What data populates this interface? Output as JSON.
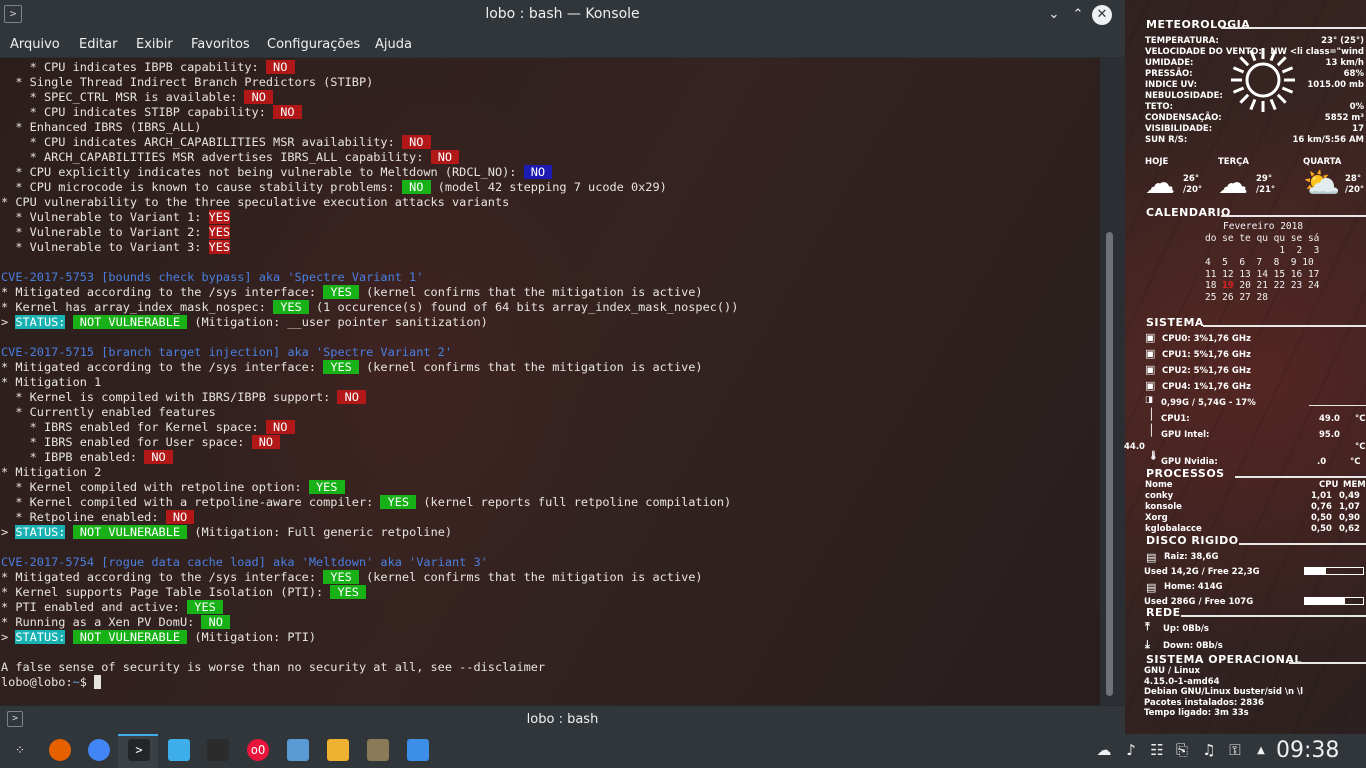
{
  "window": {
    "title": "lobo : bash — Konsole",
    "status_title": "lobo : bash"
  },
  "menu": [
    "Arquivo",
    "Editar",
    "Exibir",
    "Favoritos",
    "Configurações",
    "Ajuda"
  ],
  "terminal": {
    "lines": [
      [
        [
          "",
          "    * CPU indicates IBPB capability: "
        ],
        [
          "b-red",
          " NO "
        ]
      ],
      [
        [
          "",
          "  * Single Thread Indirect Branch Predictors (STIBP)"
        ]
      ],
      [
        [
          "",
          "    * SPEC_CTRL MSR is available: "
        ],
        [
          "b-red",
          " NO "
        ]
      ],
      [
        [
          "",
          "    * CPU indicates STIBP capability: "
        ],
        [
          "b-red",
          " NO "
        ]
      ],
      [
        [
          "",
          "  * Enhanced IBRS (IBRS_ALL)"
        ]
      ],
      [
        [
          "",
          "    * CPU indicates ARCH_CAPABILITIES MSR availability: "
        ],
        [
          "b-red",
          " NO "
        ]
      ],
      [
        [
          "",
          "    * ARCH_CAPABILITIES MSR advertises IBRS_ALL capability: "
        ],
        [
          "b-red",
          " NO "
        ]
      ],
      [
        [
          "",
          "  * CPU explicitly indicates not being vulnerable to Meltdown (RDCL_NO): "
        ],
        [
          "b-navy",
          " NO "
        ]
      ],
      [
        [
          "",
          "  * CPU microcode is known to cause stability problems: "
        ],
        [
          "b-green",
          " NO "
        ],
        [
          "",
          " (model 42 stepping 7 ucode 0x29)"
        ]
      ],
      [
        [
          "",
          "* CPU vulnerability to the three speculative execution attacks variants"
        ]
      ],
      [
        [
          "",
          "  * Vulnerable to Variant 1: "
        ],
        [
          "b-red",
          "YES"
        ]
      ],
      [
        [
          "",
          "  * Vulnerable to Variant 2: "
        ],
        [
          "b-red",
          "YES"
        ]
      ],
      [
        [
          "",
          "  * Vulnerable to Variant 3: "
        ],
        [
          "b-red",
          "YES"
        ]
      ],
      [],
      [
        [
          "c-blue",
          "CVE-2017-5753 [bounds check bypass] aka 'Spectre Variant 1'"
        ]
      ],
      [
        [
          "",
          "* Mitigated according to the /sys interface: "
        ],
        [
          "b-green",
          " YES "
        ],
        [
          "",
          " (kernel confirms that the mitigation is active)"
        ]
      ],
      [
        [
          "",
          "* Kernel has array_index_mask_nospec: "
        ],
        [
          "b-green",
          " YES "
        ],
        [
          "",
          " (1 occurence(s) found of 64 bits array_index_mask_nospec())"
        ]
      ],
      [
        [
          "",
          "> "
        ],
        [
          "b-cyan",
          "STATUS:"
        ],
        [
          "",
          " "
        ],
        [
          "b-green",
          " NOT VULNERABLE "
        ],
        [
          "",
          " (Mitigation: __user pointer sanitization)"
        ]
      ],
      [],
      [
        [
          "c-blue",
          "CVE-2017-5715 [branch target injection] aka 'Spectre Variant 2'"
        ]
      ],
      [
        [
          "",
          "* Mitigated according to the /sys interface: "
        ],
        [
          "b-green",
          " YES "
        ],
        [
          "",
          " (kernel confirms that the mitigation is active)"
        ]
      ],
      [
        [
          "",
          "* Mitigation 1"
        ]
      ],
      [
        [
          "",
          "  * Kernel is compiled with IBRS/IBPB support: "
        ],
        [
          "b-red",
          " NO "
        ]
      ],
      [
        [
          "",
          "  * Currently enabled features"
        ]
      ],
      [
        [
          "",
          "    * IBRS enabled for Kernel space: "
        ],
        [
          "b-red",
          " NO "
        ]
      ],
      [
        [
          "",
          "    * IBRS enabled for User space: "
        ],
        [
          "b-red",
          " NO "
        ]
      ],
      [
        [
          "",
          "    * IBPB enabled: "
        ],
        [
          "b-red",
          " NO "
        ]
      ],
      [
        [
          "",
          "* Mitigation 2"
        ]
      ],
      [
        [
          "",
          "  * Kernel compiled with retpoline option: "
        ],
        [
          "b-green",
          " YES "
        ]
      ],
      [
        [
          "",
          "  * Kernel compiled with a retpoline-aware compiler: "
        ],
        [
          "b-green",
          " YES "
        ],
        [
          "",
          " (kernel reports full retpoline compilation)"
        ]
      ],
      [
        [
          "",
          "  * Retpoline enabled: "
        ],
        [
          "b-red",
          " NO "
        ]
      ],
      [
        [
          "",
          "> "
        ],
        [
          "b-cyan",
          "STATUS:"
        ],
        [
          "",
          " "
        ],
        [
          "b-green",
          " NOT VULNERABLE "
        ],
        [
          "",
          " (Mitigation: Full generic retpoline)"
        ]
      ],
      [],
      [
        [
          "c-blue",
          "CVE-2017-5754 [rogue data cache load] aka 'Meltdown' aka 'Variant 3'"
        ]
      ],
      [
        [
          "",
          "* Mitigated according to the /sys interface: "
        ],
        [
          "b-green",
          " YES "
        ],
        [
          "",
          " (kernel confirms that the mitigation is active)"
        ]
      ],
      [
        [
          "",
          "* Kernel supports Page Table Isolation (PTI): "
        ],
        [
          "b-green",
          " YES "
        ]
      ],
      [
        [
          "",
          "* PTI enabled and active: "
        ],
        [
          "b-green",
          " YES "
        ]
      ],
      [
        [
          "",
          "* Running as a Xen PV DomU: "
        ],
        [
          "b-green",
          " NO "
        ]
      ],
      [
        [
          "",
          "> "
        ],
        [
          "b-cyan",
          "STATUS:"
        ],
        [
          "",
          " "
        ],
        [
          "b-green",
          " NOT VULNERABLE "
        ],
        [
          "",
          " (Mitigation: PTI)"
        ]
      ],
      [],
      [
        [
          "",
          "A false sense of security is worse than no security at all, see --disclaimer"
        ]
      ],
      [
        [
          "",
          "lobo@lobo"
        ],
        [
          "",
          ":"
        ],
        [
          "c-lb",
          "~"
        ],
        [
          "",
          "$ "
        ],
        [
          "cursor",
          " "
        ]
      ]
    ]
  },
  "conky": {
    "meteo": {
      "title": "METEOROLOGIA",
      "rows": [
        [
          "TEMPERATURA:",
          "23° (25°)"
        ],
        [
          "VELOCIDADE DO VENTO:",
          "NW <li class=\"wind"
        ],
        [
          "UMIDADE:",
          "13 km/h"
        ],
        [
          "PRESSÃO:",
          "68%"
        ],
        [
          "INDICE UV:",
          "1015.00 mb"
        ],
        [
          "NEBULOSIDADE:",
          ""
        ],
        [
          "TETO:",
          "0%"
        ],
        [
          "CONDENSAÇÃO:",
          "5852 m³"
        ],
        [
          "VISIBILIDADE:",
          "17"
        ],
        [
          "SUN R/S:",
          "16 km/5:56 AM"
        ]
      ],
      "days": [
        {
          "name": "HOJE",
          "hi": "26°",
          "lo": "/20°"
        },
        {
          "name": "TERÇA",
          "hi": "29°",
          "lo": "/21°"
        },
        {
          "name": "QUARTA",
          "hi": "28°",
          "lo": "/20°"
        }
      ]
    },
    "calendar": {
      "title": "CALENDARIO",
      "month": "Fevereiro 2018",
      "header": "do se te qu qu se sá",
      "weeks": [
        "             1  2  3",
        "4  5  6  7  8  9 10",
        "11 12 13 14 15 16 17",
        "18 19 20 21 22 23 24",
        "25 26 27 28"
      ],
      "today": "19"
    },
    "system": {
      "title": "SISTEMA",
      "cpus": [
        [
          "CPU0: 3%",
          "1,76 GHz"
        ],
        [
          "CPU1: 5%",
          "1,76 GHz"
        ],
        [
          "CPU2: 5%",
          "1,76 GHz"
        ],
        [
          "CPU4: 1%",
          "1,76 GHz"
        ]
      ],
      "mem": "0,99G / 5,74G - 17%",
      "temps": [
        [
          "CPU1:",
          "49.0",
          "°C"
        ],
        [
          "GPU Intel:",
          "95.0",
          "°C"
        ]
      ],
      "stray": "44.0",
      "nvidia": [
        "GPU Nvidia:",
        ".0",
        "°C"
      ]
    },
    "processes": {
      "title": "PROCESSOS",
      "head": [
        "Nome",
        "CPU",
        "MEM"
      ],
      "rows": [
        [
          "conky",
          "1,01",
          "0,49"
        ],
        [
          "konsole",
          "0,76",
          "1,07"
        ],
        [
          "Xorg",
          "0,50",
          "0,90"
        ],
        [
          "kglobalacce",
          "0,50",
          "0,62"
        ]
      ]
    },
    "disk": {
      "title": "DISCO RIGIDO",
      "items": [
        {
          "name": "Raiz: 38,6G",
          "usage": "Used 14,2G / Free 22,3G",
          "fill": 0.37
        },
        {
          "name": "Home: 414G",
          "usage": "Used 286G / Free 107G",
          "fill": 0.69
        }
      ]
    },
    "net": {
      "title": "REDE",
      "up": "Up: 0Bb/s",
      "down": "Down: 0Bb/s"
    },
    "os": {
      "title": "SISTEMA OPERACIONAL",
      "lines": [
        "GNU / Linux",
        "4.15.0-1-amd64",
        "Debian GNU/Linux buster/sid \\n \\l",
        "Pacotes instalados: 2836",
        "Tempo ligado: 3m 33s"
      ]
    }
  },
  "taskbar": {
    "clock": "09:38",
    "apps": [
      "launcher-icon",
      "firefox-icon",
      "chrome-icon",
      "konsole-icon",
      "files-icon",
      "terminal-icon",
      "music-icon",
      "image-viewer-icon",
      "paint-icon",
      "gimp-icon",
      "document-icon"
    ],
    "tray": [
      "cloud-icon",
      "volume-icon",
      "network-icon",
      "clipboard-icon",
      "speaker-icon",
      "lock-icon",
      "up-arrow-icon"
    ]
  }
}
